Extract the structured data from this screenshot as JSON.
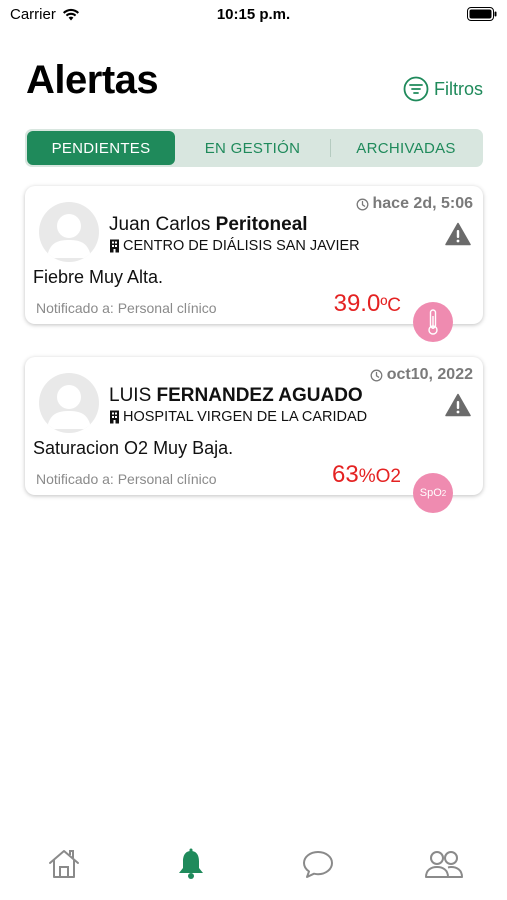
{
  "status_bar": {
    "carrier": "Carrier",
    "time": "10:15 p.m."
  },
  "header": {
    "title": "Alertas",
    "filter_label": "Filtros"
  },
  "tabs": [
    {
      "label": "PENDIENTES",
      "active": true
    },
    {
      "label": "EN GESTIÓN",
      "active": false
    },
    {
      "label": "ARCHIVADAS",
      "active": false
    }
  ],
  "alerts": [
    {
      "timestamp": "hace 2d, 5:06",
      "first_name": "Juan Carlos",
      "surname": "Peritoneal",
      "facility": "CENTRO DE DIÁLISIS SAN JAVIER",
      "message": "Fiebre Muy Alta.",
      "notified": "Notificado a: Personal clínico",
      "reading_value": "39.0",
      "reading_unit": "ºC",
      "metric_icon": "thermometer-icon"
    },
    {
      "timestamp": "oct10, 2022",
      "first_name": "LUIS",
      "surname": "FERNANDEZ AGUADO",
      "facility": "HOSPITAL VIRGEN DE LA CARIDAD",
      "message": "Saturacion O2 Muy Baja.",
      "notified": "Notificado a: Personal clínico",
      "reading_value": "63",
      "reading_unit": "%O2",
      "metric_label": "SpO"
    }
  ],
  "tab_bar": [
    {
      "icon": "home-icon",
      "active": false
    },
    {
      "icon": "bell-icon",
      "active": true
    },
    {
      "icon": "chat-icon",
      "active": false
    },
    {
      "icon": "users-icon",
      "active": false
    }
  ],
  "colors": {
    "accent": "#1f8a5b",
    "segment_bg": "#d8e6df",
    "reading": "#e42222",
    "badge": "#ef8bb0",
    "muted": "#8a8a8a"
  }
}
